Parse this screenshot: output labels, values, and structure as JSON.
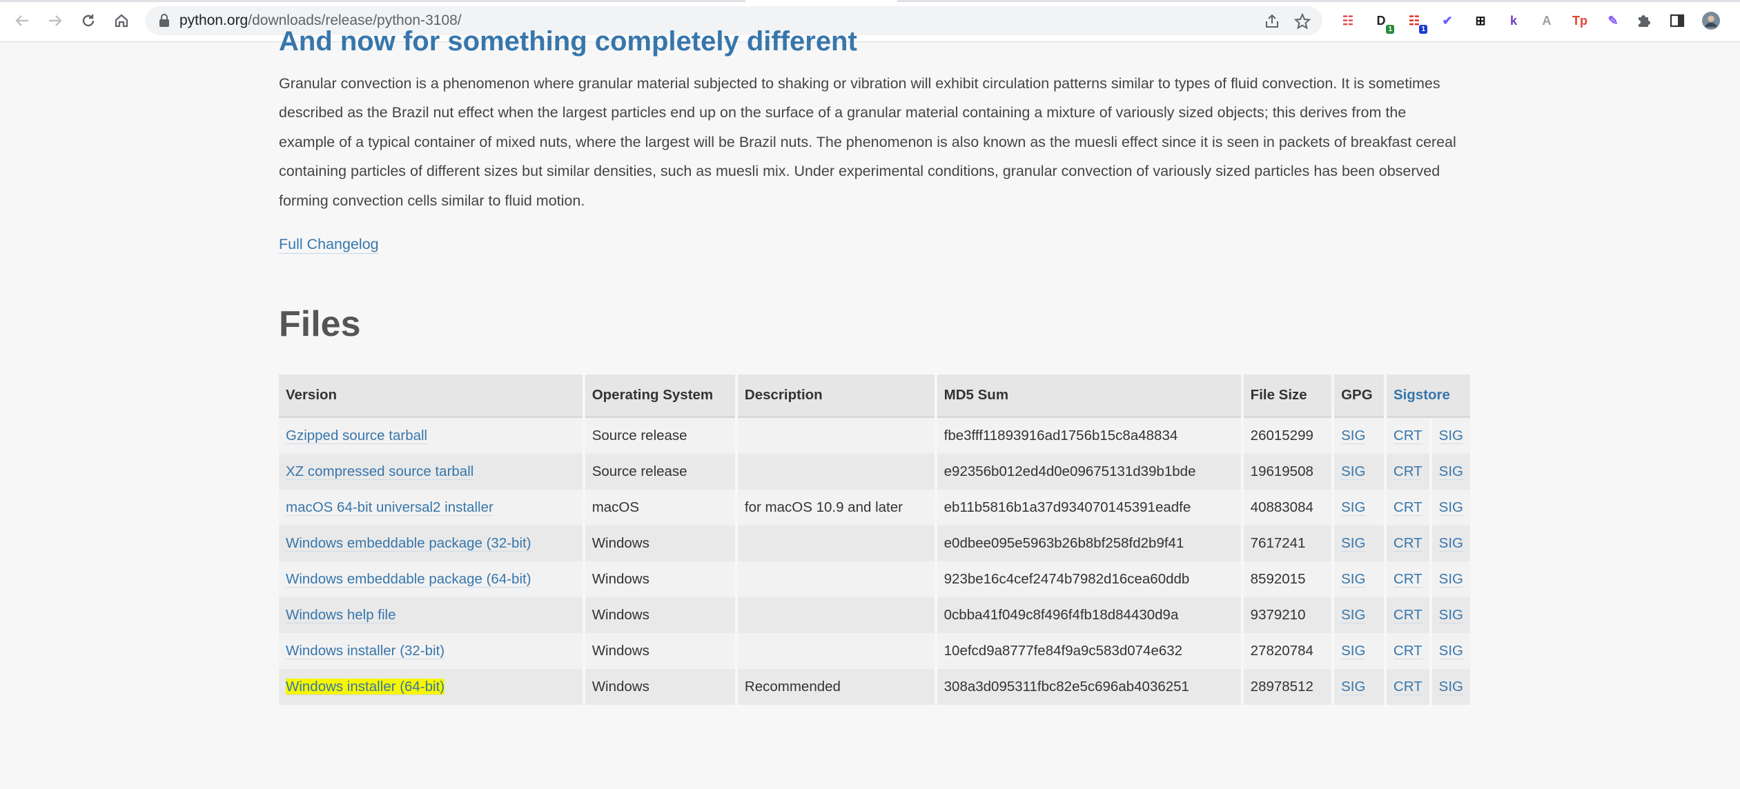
{
  "browser": {
    "url_host": "python.org",
    "url_path": "/downloads/release/python-3108/",
    "extensions": [
      {
        "name": "ext-1-icon",
        "glyph": "☷",
        "color": "#e34c4c"
      },
      {
        "name": "ext-2-icon",
        "glyph": "D",
        "color": "#222222",
        "badge": "1",
        "badge_color": "#2a8a3a"
      },
      {
        "name": "ext-3-icon",
        "glyph": "☷",
        "color": "#d93025",
        "badge": "1",
        "badge_color": "#1a3ccf"
      },
      {
        "name": "ext-4-icon",
        "glyph": "✔",
        "color": "#6b5cff"
      },
      {
        "name": "ext-5-icon",
        "glyph": "⊞",
        "color": "#111111"
      },
      {
        "name": "ext-6-icon",
        "glyph": "k",
        "color": "#6e3cc9"
      },
      {
        "name": "ext-7-icon",
        "glyph": "A",
        "color": "#9e9e9e"
      },
      {
        "name": "ext-8-icon",
        "glyph": "Tp",
        "color": "#e0452f"
      },
      {
        "name": "ext-9-icon",
        "glyph": "✎",
        "color": "#8a5cf5"
      }
    ]
  },
  "page": {
    "section_heading": "And now for something completely different",
    "paragraph": "Granular convection is a phenomenon where granular material subjected to shaking or vibration will exhibit circulation patterns similar to types of fluid convection. It is sometimes described as the Brazil nut effect when the largest particles end up on the surface of a granular material containing a mixture of variously sized objects; this derives from the example of a typical container of mixed nuts, where the largest will be Brazil nuts. The phenomenon is also known as the muesli effect since it is seen in packets of breakfast cereal containing particles of different sizes but similar densities, such as muesli mix. Under experimental conditions, granular convection of variously sized particles has been observed forming convection cells similar to fluid motion.",
    "changelog_link": "Full Changelog",
    "files_heading": "Files"
  },
  "table": {
    "headers": [
      "Version",
      "Operating System",
      "Description",
      "MD5 Sum",
      "File Size",
      "GPG",
      "Sigstore"
    ],
    "rows": [
      {
        "version": "Gzipped source tarball",
        "os": "Source release",
        "desc": "",
        "md5": "fbe3fff11893916ad1756b15c8a48834",
        "size": "26015299",
        "gpg": "SIG",
        "crt": "CRT",
        "sig": "SIG"
      },
      {
        "version": "XZ compressed source tarball",
        "os": "Source release",
        "desc": "",
        "md5": "e92356b012ed4d0e09675131d39b1bde",
        "size": "19619508",
        "gpg": "SIG",
        "crt": "CRT",
        "sig": "SIG"
      },
      {
        "version": "macOS 64-bit universal2 installer",
        "os": "macOS",
        "desc": "for macOS 10.9 and later",
        "md5": "eb11b5816b1a37d934070145391eadfe",
        "size": "40883084",
        "gpg": "SIG",
        "crt": "CRT",
        "sig": "SIG"
      },
      {
        "version": "Windows embeddable package (32-bit)",
        "os": "Windows",
        "desc": "",
        "md5": "e0dbee095e5963b26b8bf258fd2b9f41",
        "size": "7617241",
        "gpg": "SIG",
        "crt": "CRT",
        "sig": "SIG"
      },
      {
        "version": "Windows embeddable package (64-bit)",
        "os": "Windows",
        "desc": "",
        "md5": "923be16c4cef2474b7982d16cea60ddb",
        "size": "8592015",
        "gpg": "SIG",
        "crt": "CRT",
        "sig": "SIG"
      },
      {
        "version": "Windows help file",
        "os": "Windows",
        "desc": "",
        "md5": "0cbba41f049c8f496f4fb18d84430d9a",
        "size": "9379210",
        "gpg": "SIG",
        "crt": "CRT",
        "sig": "SIG"
      },
      {
        "version": "Windows installer (32-bit)",
        "os": "Windows",
        "desc": "",
        "md5": "10efcd9a8777fe84f9a9c583d074e632",
        "size": "27820784",
        "gpg": "SIG",
        "crt": "CRT",
        "sig": "SIG"
      },
      {
        "version": "Windows installer (64-bit)",
        "os": "Windows",
        "desc": "Recommended",
        "md5": "308a3d095311fbc82e5c696ab4036251",
        "size": "28978512",
        "gpg": "SIG",
        "crt": "CRT",
        "sig": "SIG",
        "highlighted": true
      }
    ]
  },
  "colors": {
    "link": "#3776ab",
    "highlight": "#f6f600"
  }
}
